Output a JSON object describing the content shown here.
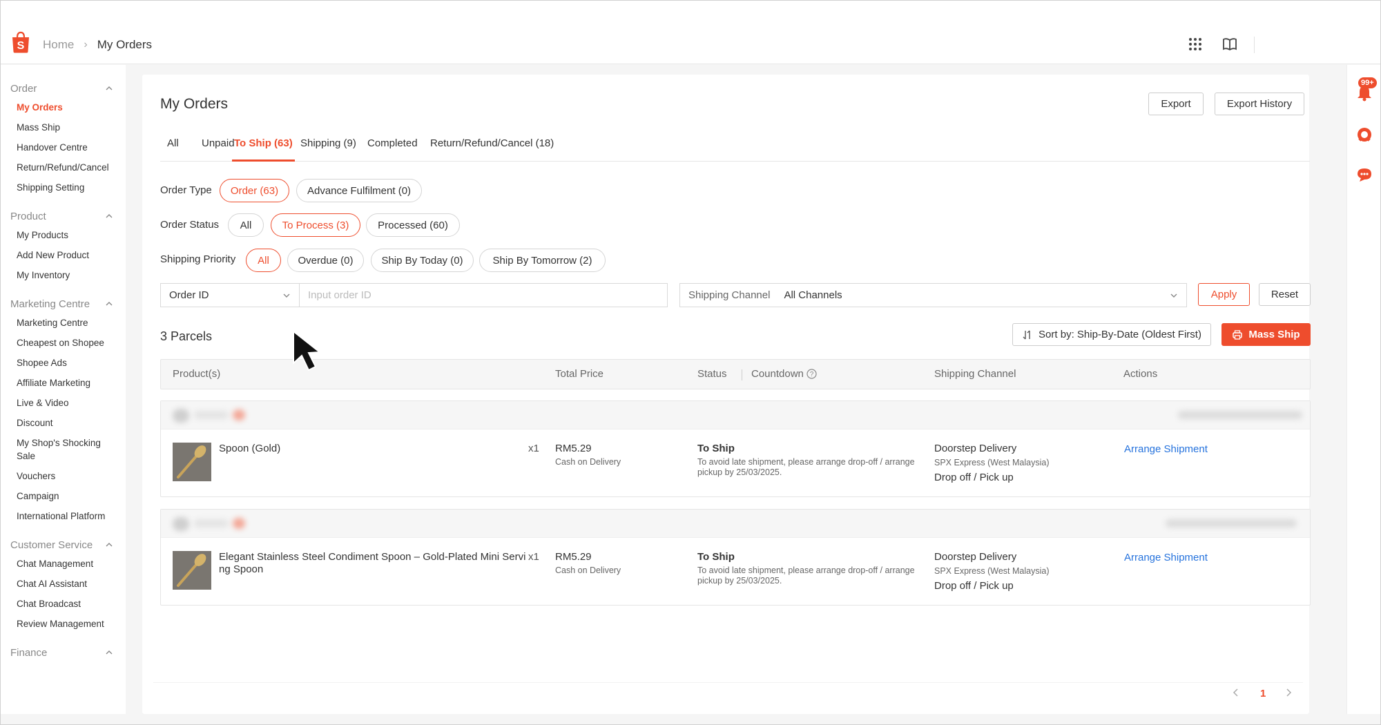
{
  "breadcrumb": {
    "home": "Home",
    "current": "My Orders"
  },
  "notifications": {
    "count": "99+"
  },
  "sidebar": {
    "sections": [
      {
        "title": "Order",
        "items": [
          "My Orders",
          "Mass Ship",
          "Handover Centre",
          "Return/Refund/Cancel",
          "Shipping Setting"
        ]
      },
      {
        "title": "Product",
        "items": [
          "My Products",
          "Add New Product",
          "My Inventory"
        ]
      },
      {
        "title": "Marketing Centre",
        "items": [
          "Marketing Centre",
          "Cheapest on Shopee",
          "Shopee Ads",
          "Affiliate Marketing",
          "Live & Video",
          "Discount",
          "My Shop's Shocking Sale",
          "Vouchers",
          "Campaign",
          "International Platform"
        ]
      },
      {
        "title": "Customer Service",
        "items": [
          "Chat Management",
          "Chat AI Assistant",
          "Chat Broadcast",
          "Review Management"
        ]
      },
      {
        "title": "Finance",
        "items": []
      }
    ],
    "active_item": "My Orders"
  },
  "page": {
    "title": "My Orders",
    "export_label": "Export",
    "export_history_label": "Export History",
    "tabs": [
      "All",
      "Unpaid",
      "To Ship (63)",
      "Shipping (9)",
      "Completed",
      "Return/Refund/Cancel (18)"
    ],
    "active_tab": "To Ship (63)"
  },
  "filters": {
    "order_type": {
      "label": "Order Type",
      "options": [
        "Order (63)",
        "Advance Fulfilment (0)"
      ],
      "selected": "Order (63)"
    },
    "order_status": {
      "label": "Order Status",
      "options": [
        "All",
        "To Process (3)",
        "Processed (60)"
      ],
      "selected": "To Process (3)"
    },
    "shipping_priority": {
      "label": "Shipping Priority",
      "options": [
        "All",
        "Overdue (0)",
        "Ship By Today (0)",
        "Ship By Tomorrow (2)"
      ],
      "selected": "All"
    },
    "search": {
      "field": "Order ID",
      "placeholder": "Input order ID",
      "value": ""
    },
    "shipping_channel": {
      "label": "Shipping Channel",
      "value": "All Channels"
    },
    "apply_label": "Apply",
    "reset_label": "Reset"
  },
  "results": {
    "count_label": "3 Parcels",
    "sort_label": "Sort by: Ship-By-Date (Oldest First)",
    "mass_ship_label": "Mass Ship",
    "columns": [
      "Product(s)",
      "Total Price",
      "Status",
      "Countdown",
      "Shipping Channel",
      "Actions"
    ]
  },
  "orders": [
    {
      "product": "Spoon (Gold)",
      "qty": "x1",
      "price": "RM5.29",
      "payment": "Cash on Delivery",
      "status": "To Ship",
      "status_note": "To avoid late shipment, please arrange drop-off / arrange pickup by 25/03/2025.",
      "shipping_type": "Doorstep Delivery",
      "carrier": "SPX Express (West Malaysia)",
      "shipping_mode": "Drop off / Pick up",
      "action": "Arrange Shipment"
    },
    {
      "product": "Elegant Stainless Steel Condiment Spoon – Gold-Plated Mini Servi ng Spoon",
      "qty": "x1",
      "price": "RM5.29",
      "payment": "Cash on Delivery",
      "status": "To Ship",
      "status_note": "To avoid late shipment, please arrange drop-off / arrange pickup by 25/03/2025.",
      "shipping_type": "Doorstep Delivery",
      "carrier": "SPX Express (West Malaysia)",
      "shipping_mode": "Drop off / Pick up",
      "action": "Arrange Shipment"
    }
  ],
  "pagination": {
    "current": "1"
  },
  "colors": {
    "brand": "#ee4d2d",
    "link": "#2673dd"
  }
}
